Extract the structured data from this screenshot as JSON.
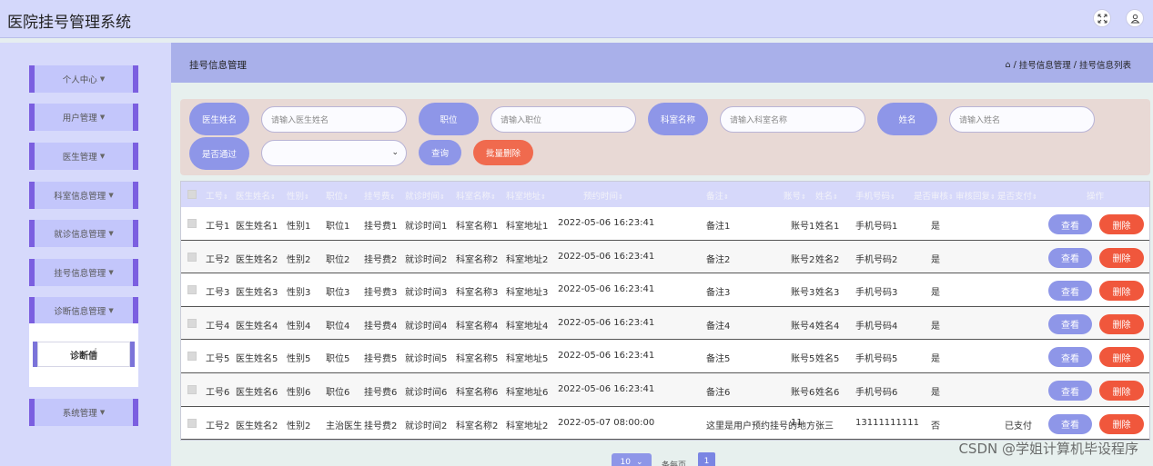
{
  "app": {
    "title": "医院挂号管理系统"
  },
  "header_icons": [
    "fullscreen-icon",
    "user-icon"
  ],
  "sidebar": {
    "items": [
      {
        "label": "个人中心"
      },
      {
        "label": "用户管理"
      },
      {
        "label": "医生管理"
      },
      {
        "label": "科室信息管理"
      },
      {
        "label": "就诊信息管理"
      },
      {
        "label": "挂号信息管理"
      },
      {
        "label": "诊断信息管理"
      },
      {
        "label": "系统管理"
      }
    ],
    "submenu_item": "诊断信"
  },
  "page": {
    "title": "挂号信息管理",
    "breadcrumb": {
      "part1": "挂号信息管理",
      "sep": "/",
      "part2": "挂号信息列表"
    }
  },
  "search": {
    "doctor_label": "医生姓名",
    "doctor_placeholder": "请输入医生姓名",
    "position_label": "职位",
    "position_placeholder": "请输入职位",
    "dept_label": "科室名称",
    "dept_placeholder": "请输入科室名称",
    "name_label": "姓名",
    "name_placeholder": "请输入姓名",
    "approved_label": "是否通过",
    "query_button": "查询",
    "batch_delete_button": "批量删除"
  },
  "table": {
    "headers": [
      "工号",
      "医生姓名",
      "性别",
      "职位",
      "挂号费",
      "就诊时间",
      "科室名称",
      "科室地址",
      "预约时间",
      "备注",
      "账号",
      "姓名",
      "手机号码",
      "是否审核",
      "审核回复",
      "是否支付",
      "操作"
    ],
    "rows": [
      [
        "工号1",
        "医生姓名1",
        "性别1",
        "职位1",
        "挂号费1",
        "就诊时间1",
        "科室名称1",
        "科室地址1",
        "2022-05-06 16:23:41",
        "备注1",
        "账号1",
        "姓名1",
        "手机号码1",
        "是",
        "",
        ""
      ],
      [
        "工号2",
        "医生姓名2",
        "性别2",
        "职位2",
        "挂号费2",
        "就诊时间2",
        "科室名称2",
        "科室地址2",
        "2022-05-06 16:23:41",
        "备注2",
        "账号2",
        "姓名2",
        "手机号码2",
        "是",
        "",
        ""
      ],
      [
        "工号3",
        "医生姓名3",
        "性别3",
        "职位3",
        "挂号费3",
        "就诊时间3",
        "科室名称3",
        "科室地址3",
        "2022-05-06 16:23:41",
        "备注3",
        "账号3",
        "姓名3",
        "手机号码3",
        "是",
        "",
        ""
      ],
      [
        "工号4",
        "医生姓名4",
        "性别4",
        "职位4",
        "挂号费4",
        "就诊时间4",
        "科室名称4",
        "科室地址4",
        "2022-05-06 16:23:41",
        "备注4",
        "账号4",
        "姓名4",
        "手机号码4",
        "是",
        "",
        ""
      ],
      [
        "工号5",
        "医生姓名5",
        "性别5",
        "职位5",
        "挂号费5",
        "就诊时间5",
        "科室名称5",
        "科室地址5",
        "2022-05-06 16:23:41",
        "备注5",
        "账号5",
        "姓名5",
        "手机号码5",
        "是",
        "",
        ""
      ],
      [
        "工号6",
        "医生姓名6",
        "性别6",
        "职位6",
        "挂号费6",
        "就诊时间6",
        "科室名称6",
        "科室地址6",
        "2022-05-06 16:23:41",
        "备注6",
        "账号6",
        "姓名6",
        "手机号码6",
        "是",
        "",
        ""
      ],
      [
        "工号2",
        "医生姓名2",
        "性别2",
        "主治医生",
        "挂号费2",
        "就诊时间2",
        "科室名称2",
        "科室地址2",
        "2022-05-07 08:00:00",
        "这里是用户预约挂号的地方",
        "11",
        "张三",
        "13111111111",
        "否",
        "",
        "已支付"
      ]
    ],
    "view_label": "查看",
    "delete_label": "删除"
  },
  "pagination": {
    "page_size": "10",
    "per_page_text": "条每页",
    "current_page": "1"
  },
  "watermark": "CSDN @学姐计算机毕设程序"
}
